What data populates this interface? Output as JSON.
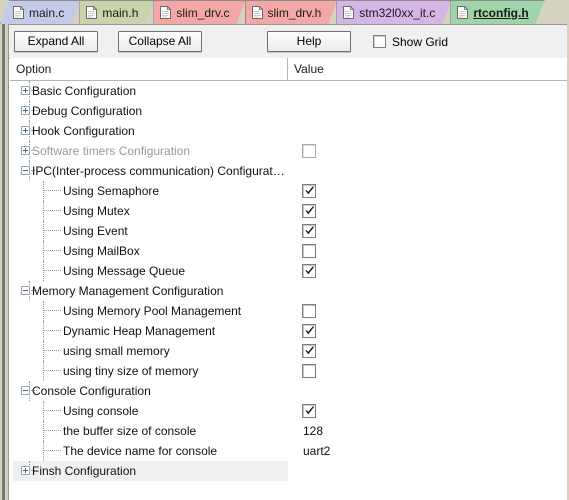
{
  "tabs": [
    {
      "label": "main.c",
      "color": "#c3cbe8",
      "icon": "document-icon",
      "active": false
    },
    {
      "label": "main.h",
      "color": "#c9d4ab",
      "icon": "document-icon",
      "active": false
    },
    {
      "label": "slim_drv.c",
      "color": "#f3a8a5",
      "icon": "document-icon",
      "active": false
    },
    {
      "label": "slim_drv.h",
      "color": "#f3a8a5",
      "icon": "document-icon",
      "active": false
    },
    {
      "label": "stm32l0xx_it.c",
      "color": "#d5b4e6",
      "icon": "document-icon",
      "active": false
    },
    {
      "label": "rtconfig.h",
      "color": "#9fd4a8",
      "icon": "document-icon",
      "active": true
    }
  ],
  "toolbar": {
    "expand_all_label": "Expand All",
    "collapse_all_label": "Collapse All",
    "help_label": "Help",
    "show_grid_label": "Show Grid",
    "show_grid_checked": false
  },
  "grid": {
    "columns": [
      "Option",
      "Value"
    ],
    "rows": [
      {
        "label": "Basic Configuration",
        "depth": 0,
        "expander": "plus",
        "value_type": "none",
        "value": "",
        "disabled": false,
        "highlight": false
      },
      {
        "label": "Debug Configuration",
        "depth": 0,
        "expander": "plus",
        "value_type": "none",
        "value": "",
        "disabled": false,
        "highlight": false
      },
      {
        "label": "Hook Configuration",
        "depth": 0,
        "expander": "plus",
        "value_type": "none",
        "value": "",
        "disabled": false,
        "highlight": false
      },
      {
        "label": "Software timers Configuration",
        "depth": 0,
        "expander": "plus",
        "value_type": "checkbox",
        "value": "unchecked",
        "disabled": true,
        "highlight": false
      },
      {
        "label": "IPC(Inter-process communication) Configurat…",
        "depth": 0,
        "expander": "minus",
        "value_type": "none",
        "value": "",
        "disabled": false,
        "highlight": false
      },
      {
        "label": "Using Semaphore",
        "depth": 1,
        "expander": "none",
        "value_type": "checkbox",
        "value": "checked",
        "disabled": false,
        "highlight": false
      },
      {
        "label": "Using Mutex",
        "depth": 1,
        "expander": "none",
        "value_type": "checkbox",
        "value": "checked",
        "disabled": false,
        "highlight": false
      },
      {
        "label": "Using Event",
        "depth": 1,
        "expander": "none",
        "value_type": "checkbox",
        "value": "checked",
        "disabled": false,
        "highlight": false
      },
      {
        "label": "Using MailBox",
        "depth": 1,
        "expander": "none",
        "value_type": "checkbox",
        "value": "unchecked",
        "disabled": false,
        "highlight": false
      },
      {
        "label": "Using Message Queue",
        "depth": 1,
        "expander": "none",
        "value_type": "checkbox",
        "value": "checked",
        "disabled": false,
        "highlight": false
      },
      {
        "label": "Memory Management Configuration",
        "depth": 0,
        "expander": "minus",
        "value_type": "none",
        "value": "",
        "disabled": false,
        "highlight": false
      },
      {
        "label": "Using Memory Pool Management",
        "depth": 1,
        "expander": "none",
        "value_type": "checkbox",
        "value": "unchecked",
        "disabled": false,
        "highlight": false
      },
      {
        "label": "Dynamic Heap Management",
        "depth": 1,
        "expander": "none",
        "value_type": "checkbox",
        "value": "checked",
        "disabled": false,
        "highlight": false
      },
      {
        "label": "using small memory",
        "depth": 1,
        "expander": "none",
        "value_type": "checkbox",
        "value": "checked",
        "disabled": false,
        "highlight": false
      },
      {
        "label": "using tiny size of memory",
        "depth": 1,
        "expander": "none",
        "value_type": "checkbox",
        "value": "unchecked",
        "disabled": false,
        "highlight": false
      },
      {
        "label": "Console Configuration",
        "depth": 0,
        "expander": "minus",
        "value_type": "none",
        "value": "",
        "disabled": false,
        "highlight": false
      },
      {
        "label": "Using console",
        "depth": 1,
        "expander": "none",
        "value_type": "checkbox",
        "value": "checked",
        "disabled": false,
        "highlight": false
      },
      {
        "label": "the buffer size of console",
        "depth": 1,
        "expander": "none",
        "value_type": "text",
        "value": "128",
        "disabled": false,
        "highlight": false
      },
      {
        "label": "The device name for console",
        "depth": 1,
        "expander": "none",
        "value_type": "text",
        "value": "uart2",
        "disabled": false,
        "highlight": false
      },
      {
        "label": "Finsh Configuration",
        "depth": 0,
        "expander": "plus",
        "value_type": "none",
        "value": "",
        "disabled": false,
        "highlight": true
      }
    ]
  },
  "colors": {
    "tabstrip_bg": "#d6d2c2",
    "toolbar_bg": "#f0f0f0",
    "grid_bg": "#ffffff",
    "row_highlight": "#f0f0f0",
    "frame_edge": "#6f7f6f"
  }
}
